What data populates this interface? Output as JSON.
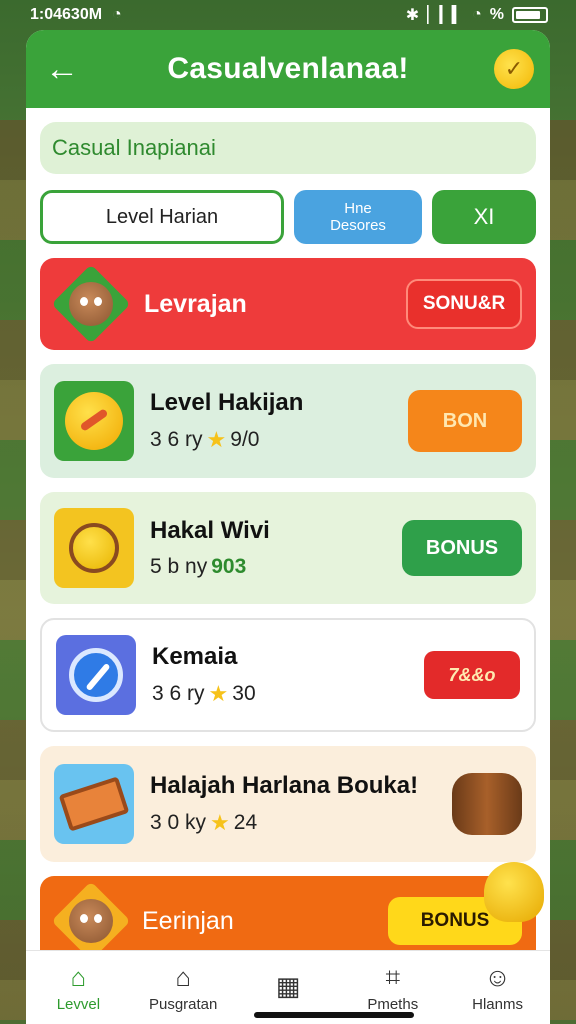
{
  "status_bar": {
    "time": "1:04630M",
    "battery_text": "%"
  },
  "header": {
    "back_icon": "back-arrow-icon",
    "title": "Casualvenlanaa!",
    "coin_icon": "coin-icon"
  },
  "subtitle": "Casual Inapianai",
  "tabs": [
    {
      "label": "Level Harian"
    },
    {
      "label_line1": "Hne",
      "label_line2": "Desores"
    },
    {
      "label": "XI"
    }
  ],
  "rows": [
    {
      "label": "Levrajan",
      "button": "SONU&R"
    },
    {
      "title": "Level Hakijan",
      "sub_prefix": "3 6 ry",
      "sub_value": "9/0",
      "button": "BON"
    },
    {
      "title": "Hakal Wivi",
      "sub_prefix": "5 b ny",
      "sub_value": "903",
      "button": "BONUS"
    },
    {
      "title": "Kemaia",
      "sub_prefix": "3 6 ry",
      "sub_value": "30",
      "button": "7&&o"
    },
    {
      "title": "Halajah Harlana Bouka!",
      "sub_prefix": "3 0 ky",
      "sub_value": "24"
    },
    {
      "label": "Eerinjan",
      "button": "BONUS"
    }
  ],
  "bottom_nav": [
    {
      "label": "Levvel",
      "icon": "home-icon",
      "active": true
    },
    {
      "label": "Pusgratan",
      "icon": "house-icon",
      "active": false
    },
    {
      "label": "",
      "icon": "calendar-icon",
      "active": false
    },
    {
      "label": "Pmeths",
      "icon": "cart-icon",
      "active": false
    },
    {
      "label": "Hlanms",
      "icon": "person-icon",
      "active": false
    }
  ],
  "colors": {
    "header_green": "#3aa33a",
    "red_row": "#ee3b3b",
    "orange_row": "#f06a12"
  }
}
